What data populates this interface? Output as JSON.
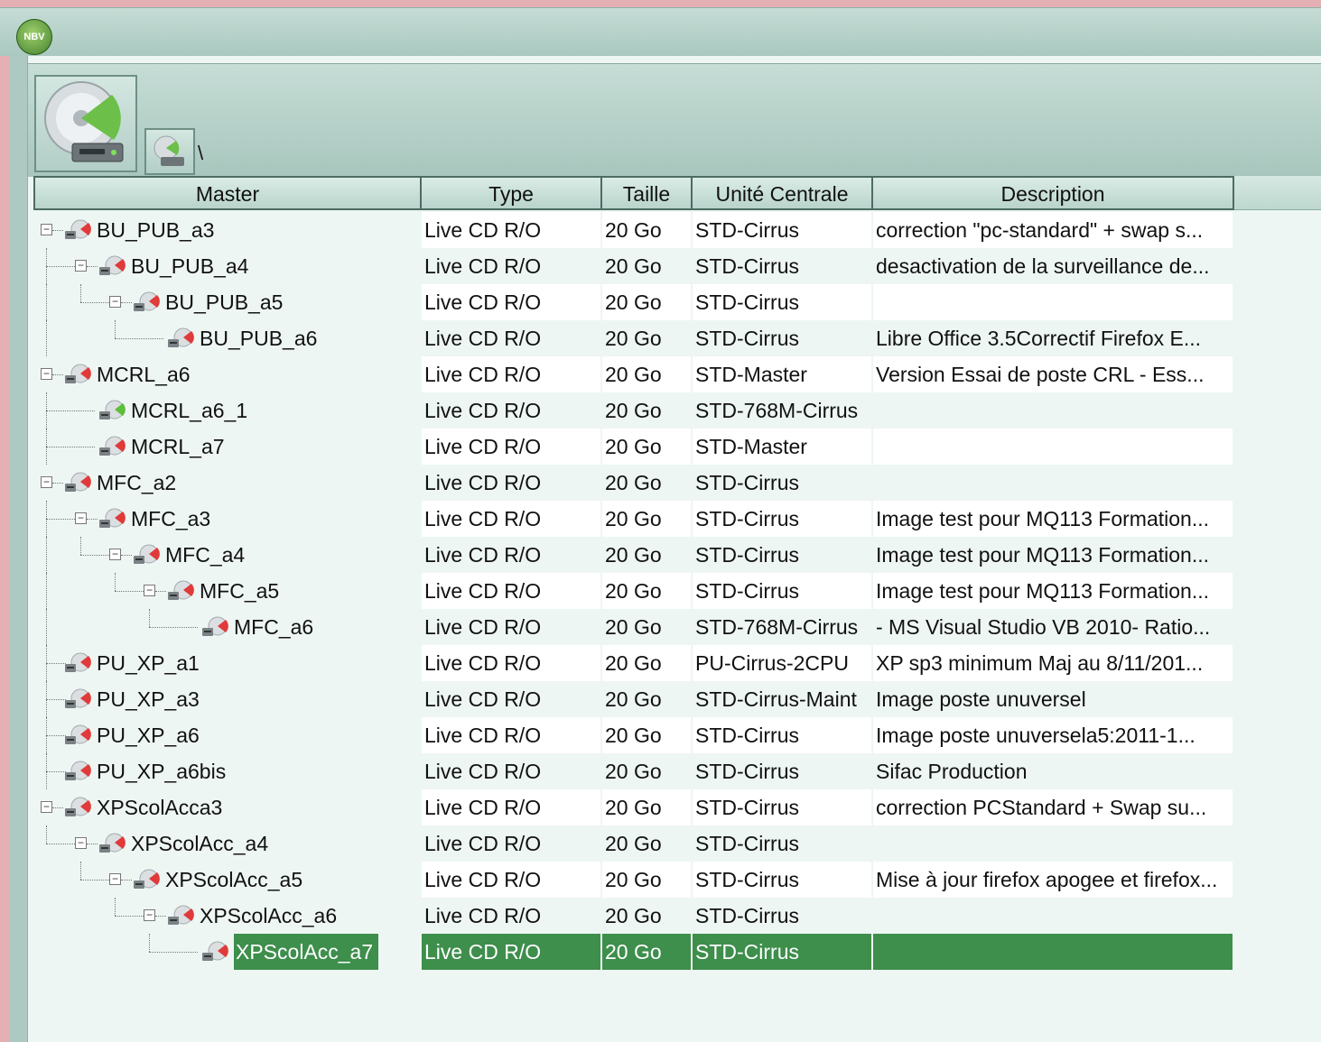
{
  "window": {
    "logo_text": "NBV",
    "path": "\\"
  },
  "columns": [
    "Master",
    "Type",
    "Taille",
    "Unité Centrale",
    "Description"
  ],
  "rows": [
    {
      "name": "BU_PUB_a3",
      "depth": 0,
      "expander": true,
      "last": false,
      "status": "red",
      "type": "Live CD R/O",
      "size": "20 Go",
      "unit": "STD-Cirrus",
      "desc": "correction \"pc-standard\" + swap s..."
    },
    {
      "name": "BU_PUB_a4",
      "depth": 1,
      "expander": true,
      "last": true,
      "status": "red",
      "type": "Live CD R/O",
      "size": "20 Go",
      "unit": "STD-Cirrus",
      "desc": "desactivation de la surveillance de..."
    },
    {
      "name": "BU_PUB_a5",
      "depth": 2,
      "expander": true,
      "last": true,
      "status": "red",
      "type": "Live CD R/O",
      "size": "20 Go",
      "unit": "STD-Cirrus",
      "desc": ""
    },
    {
      "name": "BU_PUB_a6",
      "depth": 3,
      "expander": false,
      "last": true,
      "status": "red",
      "type": "Live CD R/O",
      "size": "20 Go",
      "unit": "STD-Cirrus",
      "desc": "Libre Office 3.5Correctif Firefox  E..."
    },
    {
      "name": "MCRL_a6",
      "depth": 0,
      "expander": true,
      "last": false,
      "status": "red",
      "type": "Live CD R/O",
      "size": "20 Go",
      "unit": "STD-Master",
      "desc": "Version Essai de poste CRL - Ess..."
    },
    {
      "name": "MCRL_a6_1",
      "depth": 1,
      "expander": false,
      "last": false,
      "status": "green",
      "type": "Live CD R/O",
      "size": "20 Go",
      "unit": "STD-768M-Cirrus",
      "desc": ""
    },
    {
      "name": "MCRL_a7",
      "depth": 1,
      "expander": false,
      "last": true,
      "status": "red",
      "type": "Live CD R/O",
      "size": "20 Go",
      "unit": "STD-Master",
      "desc": ""
    },
    {
      "name": "MFC_a2",
      "depth": 0,
      "expander": true,
      "last": false,
      "status": "red",
      "type": "Live CD R/O",
      "size": "20 Go",
      "unit": "STD-Cirrus",
      "desc": ""
    },
    {
      "name": "MFC_a3",
      "depth": 1,
      "expander": true,
      "last": true,
      "status": "red",
      "type": "Live CD R/O",
      "size": "20 Go",
      "unit": "STD-Cirrus",
      "desc": "Image test pour MQ113 Formation..."
    },
    {
      "name": "MFC_a4",
      "depth": 2,
      "expander": true,
      "last": true,
      "status": "red",
      "type": "Live CD R/O",
      "size": "20 Go",
      "unit": "STD-Cirrus",
      "desc": "Image test pour MQ113 Formation..."
    },
    {
      "name": "MFC_a5",
      "depth": 3,
      "expander": true,
      "last": true,
      "status": "red",
      "type": "Live CD R/O",
      "size": "20 Go",
      "unit": "STD-Cirrus",
      "desc": "Image test pour MQ113 Formation..."
    },
    {
      "name": "MFC_a6",
      "depth": 4,
      "expander": false,
      "last": true,
      "status": "red",
      "type": "Live CD R/O",
      "size": "20 Go",
      "unit": "STD-768M-Cirrus",
      "desc": "- MS Visual Studio VB 2010- Ratio..."
    },
    {
      "name": "PU_XP_a1",
      "depth": 0,
      "expander": false,
      "last": false,
      "status": "red",
      "type": "Live CD R/O",
      "size": "20 Go",
      "unit": "PU-Cirrus-2CPU",
      "desc": "XP sp3 minimum Maj au 8/11/201..."
    },
    {
      "name": "PU_XP_a3",
      "depth": 0,
      "expander": false,
      "last": false,
      "status": "red",
      "type": "Live CD R/O",
      "size": "20 Go",
      "unit": "STD-Cirrus-Maint",
      "desc": "Image poste unuversel"
    },
    {
      "name": "PU_XP_a6",
      "depth": 0,
      "expander": false,
      "last": false,
      "status": "red",
      "type": "Live CD R/O",
      "size": "20 Go",
      "unit": "STD-Cirrus",
      "desc": "Image poste unuversela5:2011-1..."
    },
    {
      "name": "PU_XP_a6bis",
      "depth": 0,
      "expander": false,
      "last": false,
      "status": "red",
      "type": "Live CD R/O",
      "size": "20 Go",
      "unit": "STD-Cirrus",
      "desc": "Sifac Production"
    },
    {
      "name": "XPScolAcca3",
      "depth": 0,
      "expander": true,
      "last": true,
      "status": "red",
      "type": "Live CD R/O",
      "size": "20 Go",
      "unit": "STD-Cirrus",
      "desc": "correction PCStandard + Swap su..."
    },
    {
      "name": "XPScolAcc_a4",
      "depth": 1,
      "expander": true,
      "last": true,
      "status": "red",
      "type": "Live CD R/O",
      "size": "20 Go",
      "unit": "STD-Cirrus",
      "desc": ""
    },
    {
      "name": "XPScolAcc_a5",
      "depth": 2,
      "expander": true,
      "last": true,
      "status": "red",
      "type": "Live CD R/O",
      "size": "20 Go",
      "unit": "STD-Cirrus",
      "desc": "Mise à jour firefox apogee et firefox..."
    },
    {
      "name": "XPScolAcc_a6",
      "depth": 3,
      "expander": true,
      "last": true,
      "status": "red",
      "type": "Live CD R/O",
      "size": "20 Go",
      "unit": "STD-Cirrus",
      "desc": ""
    },
    {
      "name": "XPScolAcc_a7",
      "depth": 4,
      "expander": false,
      "last": true,
      "status": "red",
      "type": "Live CD R/O",
      "size": "20 Go",
      "unit": "STD-Cirrus",
      "desc": "",
      "selected": true
    }
  ],
  "colors": {
    "selection": "#3e8e4c",
    "status_red": "#e03a3a",
    "status_green": "#5bbf3b",
    "panel_bg": "#eef6f3"
  }
}
